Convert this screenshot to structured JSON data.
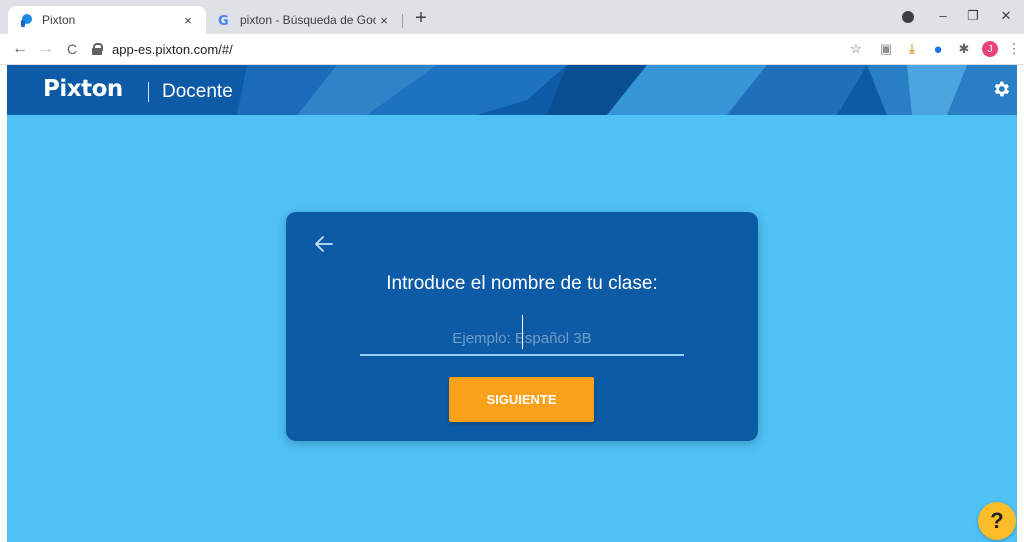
{
  "browser": {
    "tabs": [
      {
        "title": "Pixton",
        "favicon": "pixton-icon",
        "active": true
      },
      {
        "title": "pixton - Búsqueda de Google",
        "favicon": "google-icon",
        "active": false
      }
    ],
    "close_glyph": "×",
    "new_tab_glyph": "+",
    "url": "app-es.pixton.com/#/",
    "window_controls": {
      "minimize": "–",
      "restore": "❐",
      "close": "✕"
    },
    "nav": {
      "back": "←",
      "forward": "→",
      "reload": "C"
    },
    "extensions": [
      {
        "name": "star-icon",
        "glyph": "☆",
        "color": "#5f6368"
      },
      {
        "name": "pdf-extension-icon",
        "glyph": "▣",
        "color": "#8a8f94"
      },
      {
        "name": "download-extension-icon",
        "glyph": "⤓",
        "color": "#e6a23c"
      },
      {
        "name": "vpn-extension-icon",
        "glyph": "●",
        "color": "#1a73e8"
      },
      {
        "name": "extensions-puzzle-icon",
        "glyph": "✱",
        "color": "#5f6368"
      },
      {
        "name": "profile-avatar",
        "glyph": "J",
        "color": "#e8437b"
      },
      {
        "name": "more-menu-icon",
        "glyph": "⋮",
        "color": "#5f6368"
      }
    ]
  },
  "app": {
    "logo": "Pixton",
    "section": "Docente",
    "colors": {
      "header": "#0d5ba6",
      "background": "#4fc1f5",
      "card": "#0d5ba6",
      "button": "#f9a11b",
      "help": "#fbbe2a"
    }
  },
  "card": {
    "title": "Introduce el nombre de tu clase:",
    "input_placeholder": "Ejemplo: Español 3B",
    "input_value": "",
    "button_label": "SIGUIENTE"
  },
  "help": {
    "label": "?"
  }
}
